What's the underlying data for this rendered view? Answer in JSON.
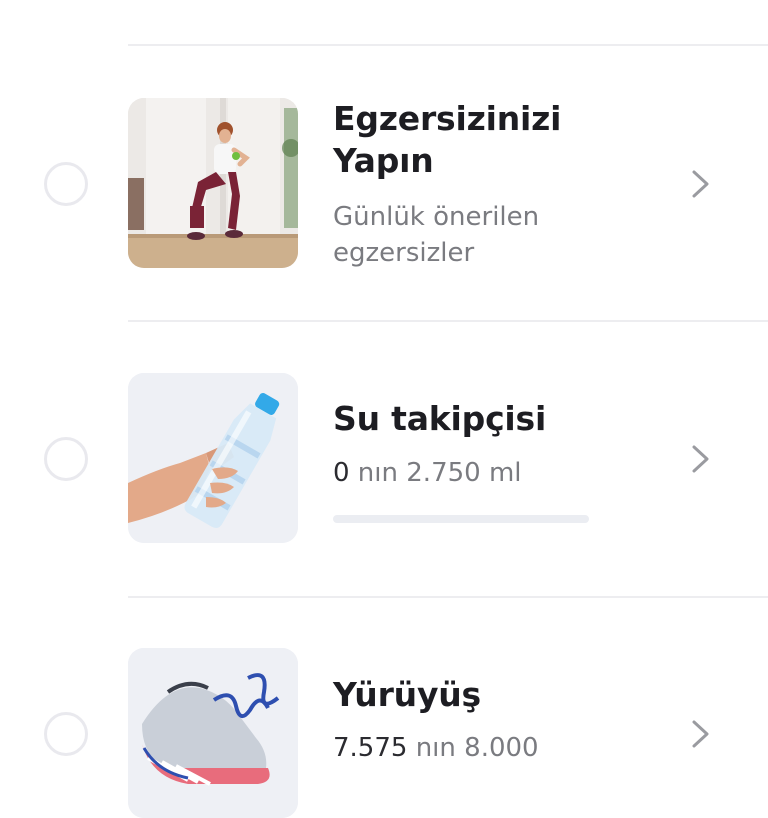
{
  "items": [
    {
      "title_line1": "Egzersizinizi",
      "title_line2": "Yapın",
      "subtitle_line1": "Günlük önerilen",
      "subtitle_line2": "egzersizler",
      "icon": "exercise-photo"
    },
    {
      "title": "Su takipçisi",
      "current": "0",
      "separator": " nın ",
      "target": "2.750 ml",
      "progress": 0,
      "icon": "water-bottle-photo"
    },
    {
      "title": "Yürüyüş",
      "current": "7.575",
      "separator": " nın ",
      "target": "8.000",
      "icon": "sneaker-photo"
    }
  ],
  "colors": {
    "divider": "#ededf0",
    "radio_border": "#e9e9ee",
    "subtitle": "#7a7b80",
    "chevron": "#9a9ba0",
    "water_blue": "#4aa3f0"
  }
}
